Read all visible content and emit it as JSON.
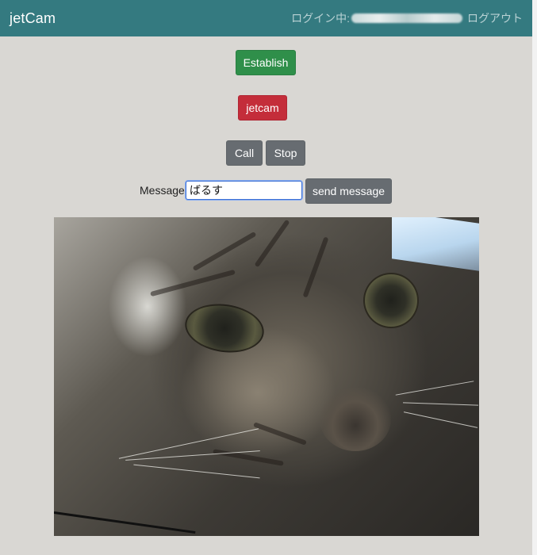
{
  "navbar": {
    "brand": "jetCam",
    "login_prefix": "ログイン中:",
    "logout": "ログアウト"
  },
  "controls": {
    "establish_label": "Establish",
    "jetcam_label": "jetcam",
    "call_label": "Call",
    "stop_label": "Stop"
  },
  "message": {
    "label": "Message",
    "value": "ばるす",
    "send_label": "send message"
  },
  "colors": {
    "navbar": "#347a80",
    "background": "#d9d7d3",
    "establish": "#2f8f4a",
    "jetcam": "#c42d3a",
    "secondary": "#676c71"
  }
}
